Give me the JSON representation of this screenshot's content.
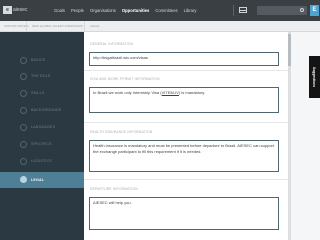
{
  "app": {
    "logo_letter": "e",
    "logo_text": "aiesec"
  },
  "nav": {
    "items": [
      "Goals",
      "People",
      "Organisations",
      "Opportunities",
      "Committees",
      "Library"
    ],
    "active_index": 3
  },
  "search": {
    "placeholder": ""
  },
  "user": {
    "avatar_letter": "E"
  },
  "breadcrumb": [
    "OPPORTUNITIES",
    "NEW GLOBAL TALENT INTERNSHIP",
    "LEGAL"
  ],
  "sidebar": {
    "items": [
      {
        "label": "BASICS"
      },
      {
        "label": "THE ROLE"
      },
      {
        "label": "SKILLS"
      },
      {
        "label": "BACKGROUNDS"
      },
      {
        "label": "LANGUAGES"
      },
      {
        "label": "SPECIFICS"
      },
      {
        "label": "LOGISTICS"
      },
      {
        "label": "LEGAL"
      }
    ],
    "active_index": 7
  },
  "form": {
    "general_title": "GENERAL INFORMATION",
    "general_value": "http://bsgalbrazil.wix.com/visas",
    "visa_title": "VISA AND WORK PERMIT INFORMATION",
    "visa_value_pre": "In Brazil we work only Internship Visa (",
    "visa_value_link": "VITEM-IV",
    "visa_value_post": ") is mandatory.",
    "health_title": "HEALTH INSURANCE INFORMATION",
    "health_value": "Health insurance is mandatory and must be presented before departure to Brazil. AIESEC can support the exchange participant to fill this requirement if it is needed.",
    "departure_title": "DEPARTURE INFORMATION",
    "departure_value": "AIESEC will help you."
  },
  "suggestions": {
    "label": "Suggestions"
  },
  "colors": {
    "topbar": "#3a3f44",
    "sidebar": "#2b3a42",
    "active_item": "#4e7f96",
    "avatar": "#4fa3d1",
    "field_border": "#4f6670"
  },
  "icons": {
    "mail": "envelope-icon",
    "search": "search-icon",
    "sidebar_marker": "circle-icon"
  }
}
